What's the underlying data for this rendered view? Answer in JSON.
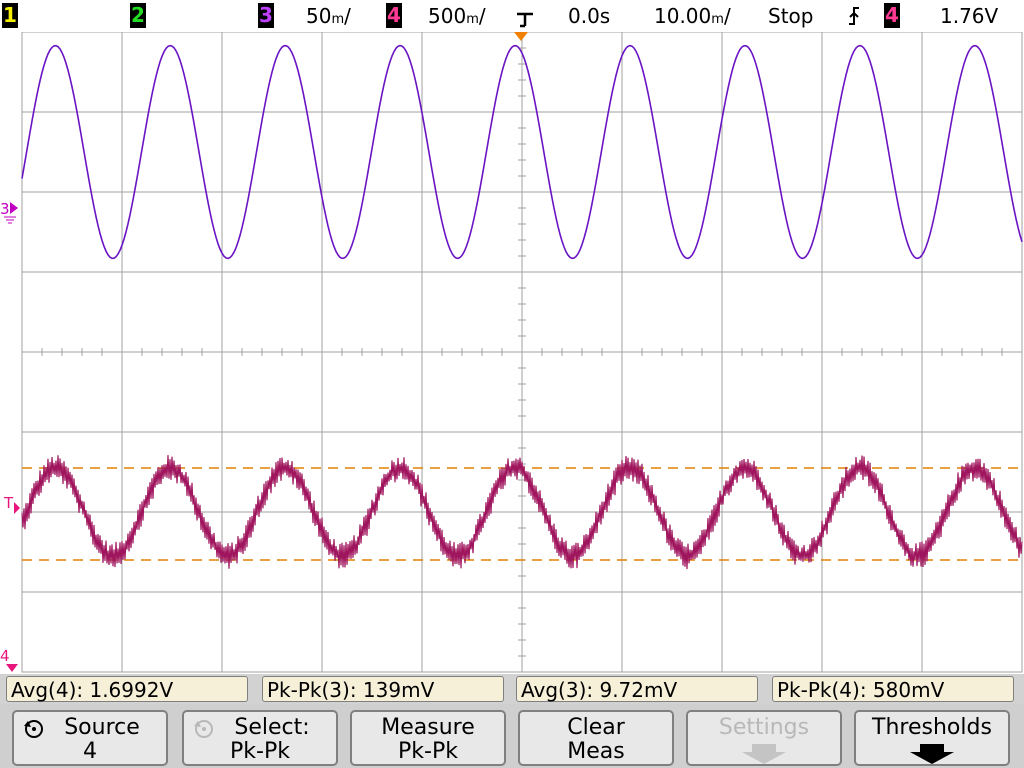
{
  "top_bar": {
    "ch1": "1",
    "ch2": "2",
    "ch3": "3",
    "ch3_scale": "50",
    "ch4": "4",
    "ch4_scale": "500",
    "time_delay": "0.0s",
    "time_div": "10.00",
    "run_state": "Stop",
    "trigger_source": "4",
    "trigger_level": "1.76V"
  },
  "colors": {
    "ch1": "#f4f000",
    "ch2": "#22dd22",
    "ch3": "#9a1cd8",
    "ch4": "#e8167c",
    "trace3": "#6a14c4",
    "trace4": "#a0165e",
    "cursor": "#e08000",
    "grid": "#a0a0a0"
  },
  "markers": {
    "ch3": "3",
    "trigger": "T",
    "ch4": "4"
  },
  "measurements": [
    {
      "label": "Avg(4): 1.6992V"
    },
    {
      "label": "Pk-Pk(3): 139mV"
    },
    {
      "label": "Avg(3): 9.72mV"
    },
    {
      "label": "Pk-Pk(4): 580mV"
    }
  ],
  "softkeys": [
    {
      "line1": "Source",
      "line2": "4",
      "enabled": true
    },
    {
      "line1": "Select:",
      "line2": "Pk-Pk",
      "enabled": false
    },
    {
      "line1": "Measure",
      "line2": "Pk-Pk",
      "enabled": true
    },
    {
      "line1": "Clear",
      "line2": "Meas",
      "enabled": true
    },
    {
      "line1": "Settings",
      "line2": "",
      "enabled": false
    },
    {
      "line1": "Thresholds",
      "line2": "",
      "enabled": true
    }
  ],
  "chart_data": {
    "type": "line",
    "x_units": "divisions",
    "xlim": [
      0,
      10
    ],
    "ylim": [
      -4,
      4
    ],
    "grid": true,
    "series": [
      {
        "cycles_per_screen": 8.7,
        "phase_cycles": 0.29,
        "amplitude_div": 1.33,
        "offset_div": 2.5
      },
      {
        "cycles_per_screen": 8.7,
        "phase_cycles": 0.29,
        "amplitude_div": 0.55,
        "offset_div": -2.0,
        "noise_div": 0.12
      }
    ],
    "cursor_levels_div": [
      -1.45,
      -2.6
    ]
  }
}
